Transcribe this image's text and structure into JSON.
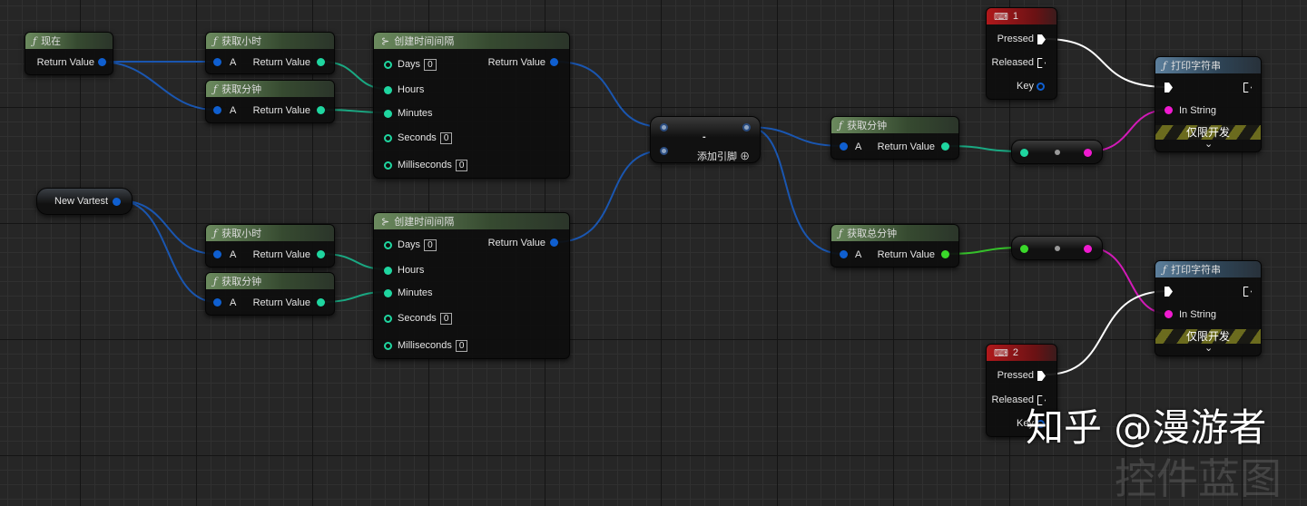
{
  "nodes": {
    "now": {
      "title": "现在",
      "out": "Return Value"
    },
    "get_hour_1": {
      "title": "获取小时",
      "in": "A",
      "out": "Return Value"
    },
    "get_min_1": {
      "title": "获取分钟",
      "in": "A",
      "out": "Return Value"
    },
    "make_timespan_1": {
      "title": "创建时间间隔",
      "days": "Days",
      "hours": "Hours",
      "minutes": "Minutes",
      "seconds": "Seconds",
      "ms": "Milliseconds",
      "days_val": "0",
      "seconds_val": "0",
      "ms_val": "0",
      "out": "Return Value"
    },
    "new_var": {
      "title": "New Vartest"
    },
    "get_hour_2": {
      "title": "获取小时",
      "in": "A",
      "out": "Return Value"
    },
    "get_min_2": {
      "title": "获取分钟",
      "in": "A",
      "out": "Return Value"
    },
    "make_timespan_2": {
      "title": "创建时间间隔",
      "days": "Days",
      "hours": "Hours",
      "minutes": "Minutes",
      "seconds": "Seconds",
      "ms": "Milliseconds",
      "days_val": "0",
      "seconds_val": "0",
      "ms_val": "0",
      "out": "Return Value"
    },
    "subtract": {
      "op": "-",
      "add_pin": "添加引脚"
    },
    "get_min_3": {
      "title": "获取分钟",
      "in": "A",
      "out": "Return Value"
    },
    "get_total_min": {
      "title": "获取总分钟",
      "in": "A",
      "out": "Return Value"
    },
    "key1": {
      "title": "1",
      "pressed": "Pressed",
      "released": "Released",
      "key": "Key"
    },
    "key2": {
      "title": "2",
      "pressed": "Pressed",
      "released": "Released",
      "key": "Key"
    },
    "print1": {
      "title": "打印字符串",
      "in_string": "In String",
      "dev_only": "仅限开发"
    },
    "print2": {
      "title": "打印字符串",
      "in_string": "In String",
      "dev_only": "仅限开发"
    }
  },
  "watermark": {
    "text": "知乎 @漫游者",
    "background_text": "控件蓝图"
  },
  "colors": {
    "struct": "#0f5fd0",
    "int": "#1fd6a0",
    "int64": "#3ad82a",
    "string": "#f01ad0",
    "exec": "#ffffff"
  }
}
